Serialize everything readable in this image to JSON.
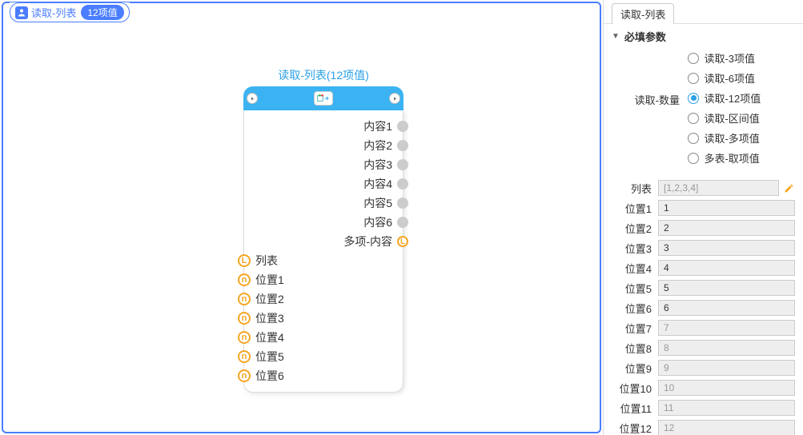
{
  "canvas": {
    "tab": {
      "label": "读取-列表",
      "badge": "12项值"
    }
  },
  "node": {
    "title": "读取-列表(12项值)",
    "outputs": [
      {
        "label": "内容1",
        "pin": "dot"
      },
      {
        "label": "内容2",
        "pin": "dot"
      },
      {
        "label": "内容3",
        "pin": "dot"
      },
      {
        "label": "内容4",
        "pin": "dot"
      },
      {
        "label": "内容5",
        "pin": "dot"
      },
      {
        "label": "内容6",
        "pin": "dot"
      },
      {
        "label": "多项-内容",
        "pin": "L"
      }
    ],
    "inputs": [
      {
        "label": "列表",
        "pin": "L"
      },
      {
        "label": "位置1",
        "pin": "n"
      },
      {
        "label": "位置2",
        "pin": "n"
      },
      {
        "label": "位置3",
        "pin": "n"
      },
      {
        "label": "位置4",
        "pin": "n"
      },
      {
        "label": "位置5",
        "pin": "n"
      },
      {
        "label": "位置6",
        "pin": "n"
      }
    ]
  },
  "panel": {
    "tab": "读取-列表",
    "section_title": "必填参数",
    "radio_group_label": "读取-数量",
    "radio_options": [
      {
        "label": "读取-3项值",
        "selected": false
      },
      {
        "label": "读取-6项值",
        "selected": false
      },
      {
        "label": "读取-12项值",
        "selected": true
      },
      {
        "label": "读取-区间值",
        "selected": false
      },
      {
        "label": "读取-多项值",
        "selected": false
      },
      {
        "label": "多表-取项值",
        "selected": false
      }
    ],
    "params": [
      {
        "label": "列表",
        "value": "[1,2,3,4]",
        "active": false,
        "editable": true
      },
      {
        "label": "位置1",
        "value": "1",
        "active": true
      },
      {
        "label": "位置2",
        "value": "2",
        "active": true
      },
      {
        "label": "位置3",
        "value": "3",
        "active": true
      },
      {
        "label": "位置4",
        "value": "4",
        "active": true
      },
      {
        "label": "位置5",
        "value": "5",
        "active": true
      },
      {
        "label": "位置6",
        "value": "6",
        "active": true
      },
      {
        "label": "位置7",
        "value": "7",
        "active": false
      },
      {
        "label": "位置8",
        "value": "8",
        "active": false
      },
      {
        "label": "位置9",
        "value": "9",
        "active": false
      },
      {
        "label": "位置10",
        "value": "10",
        "active": false
      },
      {
        "label": "位置11",
        "value": "11",
        "active": false
      },
      {
        "label": "位置12",
        "value": "12",
        "active": false
      }
    ]
  }
}
